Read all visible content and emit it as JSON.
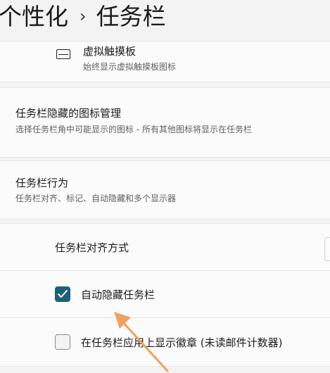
{
  "breadcrumb": {
    "parent": "个性化",
    "separator": "›",
    "current": "任务栏"
  },
  "touchpad": {
    "title": "虚拟触摸板",
    "description": "始终显示虚拟触摸板图标",
    "icon": "touchpad-icon"
  },
  "overflow_section": {
    "title": "任务栏隐藏的图标管理",
    "description": "选择任务栏角中可能显示的图标 - 所有其他图标将显示在任务栏"
  },
  "behaviors_section": {
    "title": "任务栏行为",
    "description": "任务栏对齐、标记、自动隐藏和多个显示器"
  },
  "alignment": {
    "label": "任务栏对齐方式"
  },
  "auto_hide": {
    "label": "自动隐藏任务栏",
    "checked": true
  },
  "badges": {
    "label": "在任务栏应用上显示徽章 (未读邮件计数器)",
    "checked": false
  },
  "colors": {
    "accent": "#1f5f78",
    "annotation_arrow": "#f0a060"
  }
}
